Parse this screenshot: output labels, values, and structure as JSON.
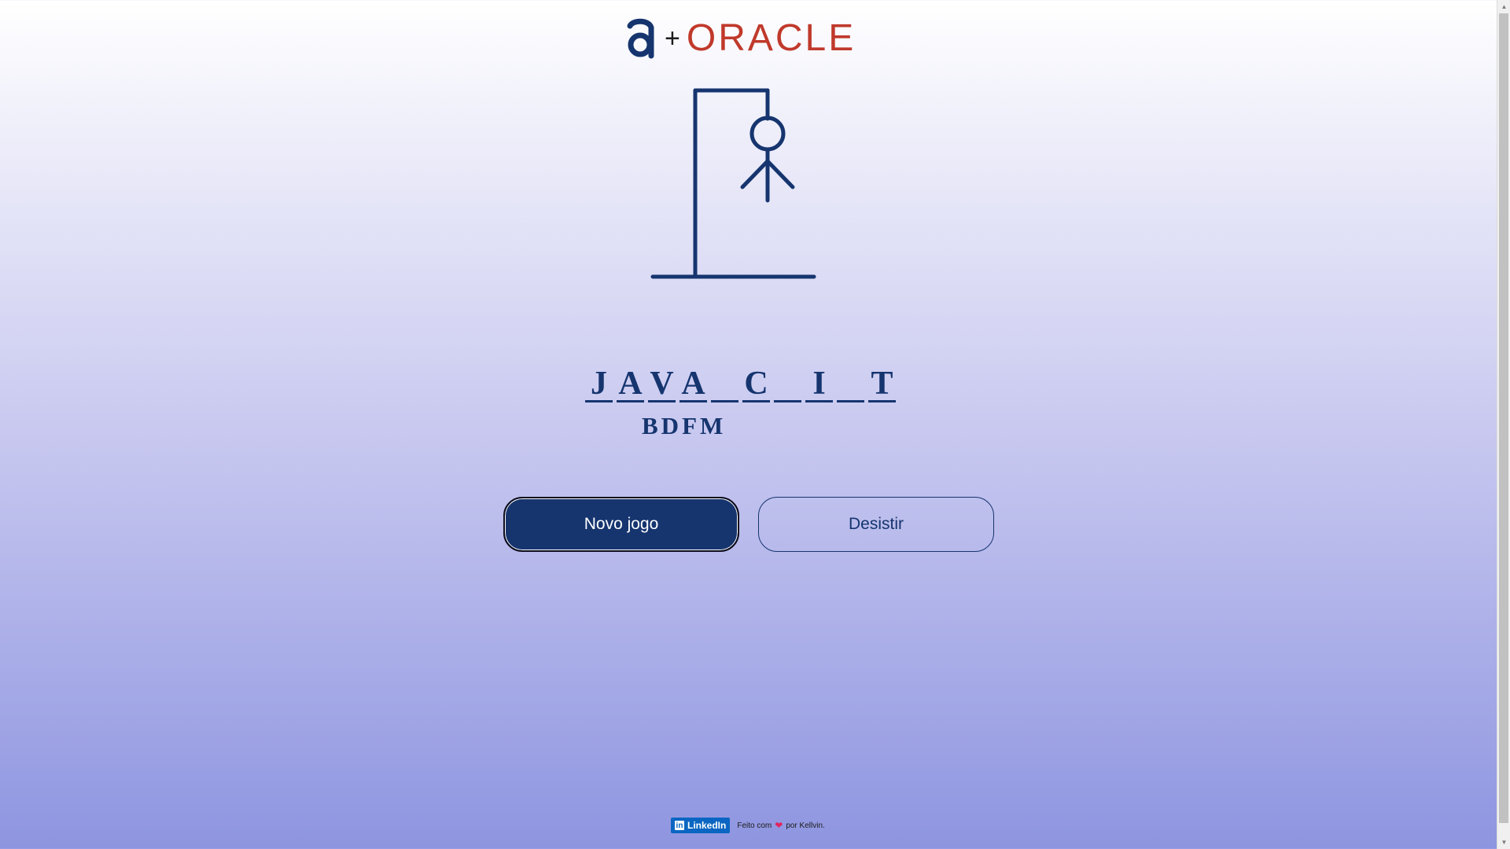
{
  "logo": {
    "brand_text": "ORACLE",
    "plus": "+"
  },
  "game": {
    "slots": [
      "J",
      "A",
      "V",
      "A",
      "",
      "C",
      "",
      "I",
      "",
      "T"
    ],
    "wrong_letters": "BDFM"
  },
  "buttons": {
    "new_game": "Novo jogo",
    "give_up": "Desistir"
  },
  "footer": {
    "linkedin_label": "LinkedIn",
    "linkedin_icon": "in",
    "made_with": "Feito com",
    "heart": "❤",
    "by": "por Kellvin."
  },
  "colors": {
    "primary": "#16356f",
    "oracle_red": "#c0392b",
    "linkedin": "#0a66c2",
    "heart": "#e0245e"
  },
  "icons": [
    "alura-a-logo",
    "linkedin-icon",
    "heart-icon",
    "scroll-up-icon",
    "scroll-down-icon"
  ]
}
